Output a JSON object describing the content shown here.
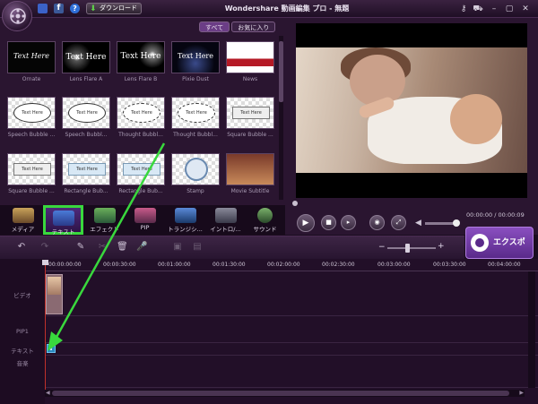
{
  "titlebar": {
    "title": "Wondershare 動画編集 プロ - 無題",
    "download_label": "ダウンロード",
    "facebook_glyph": "f",
    "help_glyph": "?"
  },
  "filters": {
    "all": "すべて",
    "favorites": "お気に入り"
  },
  "templates": [
    {
      "label": "Ornate",
      "sample": "Text Here"
    },
    {
      "label": "Lens Flare A",
      "sample": "Text Here"
    },
    {
      "label": "Lens Flare B",
      "sample": "Text Here"
    },
    {
      "label": "Pixie Dust",
      "sample": "Text Here"
    },
    {
      "label": "News",
      "sample": ""
    },
    {
      "label": "Speech Bubble ...",
      "sample": "Text Here"
    },
    {
      "label": "Speech Bubbl...",
      "sample": "Text Here"
    },
    {
      "label": "Thought Bubbl...",
      "sample": "Text Here"
    },
    {
      "label": "Thought Bubbl...",
      "sample": "Text Here"
    },
    {
      "label": "Square Bubble ...",
      "sample": "Text Here"
    },
    {
      "label": "Square Bubble ...",
      "sample": "Text Here"
    },
    {
      "label": "Rectangle Bub...",
      "sample": "Text Here"
    },
    {
      "label": "Rectangle Bub...",
      "sample": "Text Here"
    },
    {
      "label": "Stamp",
      "sample": ""
    },
    {
      "label": "Movie Subtitle",
      "sample": ""
    }
  ],
  "modules": [
    {
      "label": "メディア"
    },
    {
      "label": "テキスト"
    },
    {
      "label": "エフェクト"
    },
    {
      "label": "PIP"
    },
    {
      "label": "トランジシ..."
    },
    {
      "label": "イントロ/..."
    },
    {
      "label": "サウンド"
    }
  ],
  "player": {
    "time": "00:00:00 / 00:00:09"
  },
  "export_label": "エクスポート",
  "timeline": {
    "ruler": [
      "00:00:00:00",
      "00:00:30:00",
      "00:01:00:00",
      "00:01:30:00",
      "00:02:00:00",
      "00:02:30:00",
      "00:03:00:00",
      "00:03:30:00",
      "00:04:00:00"
    ],
    "tracks": [
      "ビデオ",
      "PIP1",
      "テキスト",
      "音楽"
    ],
    "text_clip_glyph": "T"
  },
  "colors": {
    "background": "#1b0d1f",
    "accent": "#6b3d86",
    "active_tab_border": "#39d83d",
    "annotation_arrow": "#39d83d",
    "playhead": "#c0302a"
  }
}
